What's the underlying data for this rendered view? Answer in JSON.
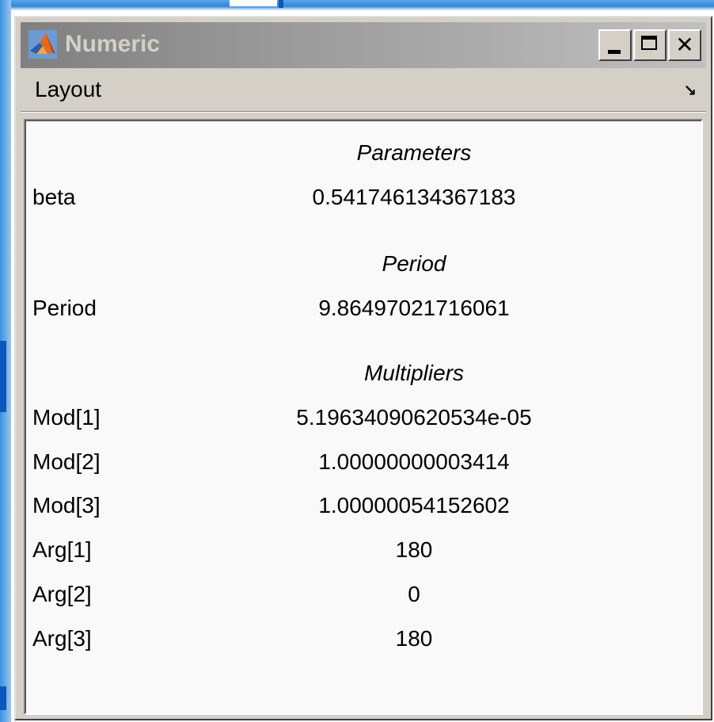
{
  "window": {
    "title": "Numeric",
    "minimize_label": "minimize",
    "maximize_label": "maximize",
    "close_label": "close"
  },
  "menubar": {
    "items": [
      {
        "label": "Layout"
      }
    ],
    "dock_icon": "undock-arrow-icon"
  },
  "panel": {
    "sections": {
      "parameters": {
        "heading": "Parameters",
        "rows": [
          {
            "label": "beta",
            "value": "0.541746134367183"
          }
        ]
      },
      "period": {
        "heading": "Period",
        "rows": [
          {
            "label": "Period",
            "value": "9.86497021716061"
          }
        ]
      },
      "multipliers": {
        "heading": "Multipliers",
        "rows": [
          {
            "label": "Mod[1]",
            "value": "5.19634090620534e-05"
          },
          {
            "label": "Mod[2]",
            "value": "1.00000000003414"
          },
          {
            "label": "Mod[3]",
            "value": "1.00000054152602"
          },
          {
            "label": "Arg[1]",
            "value": "180"
          },
          {
            "label": "Arg[2]",
            "value": "0"
          },
          {
            "label": "Arg[3]",
            "value": "180"
          }
        ]
      }
    }
  },
  "colors": {
    "window_face": "#d4d0c8",
    "panel_background": "#f9f9f9",
    "title_gradient_start": "#808080",
    "title_gradient_end": "#c0c0c0",
    "title_text": "#d4d0c8",
    "desktop_blue": "#2f86d8"
  }
}
